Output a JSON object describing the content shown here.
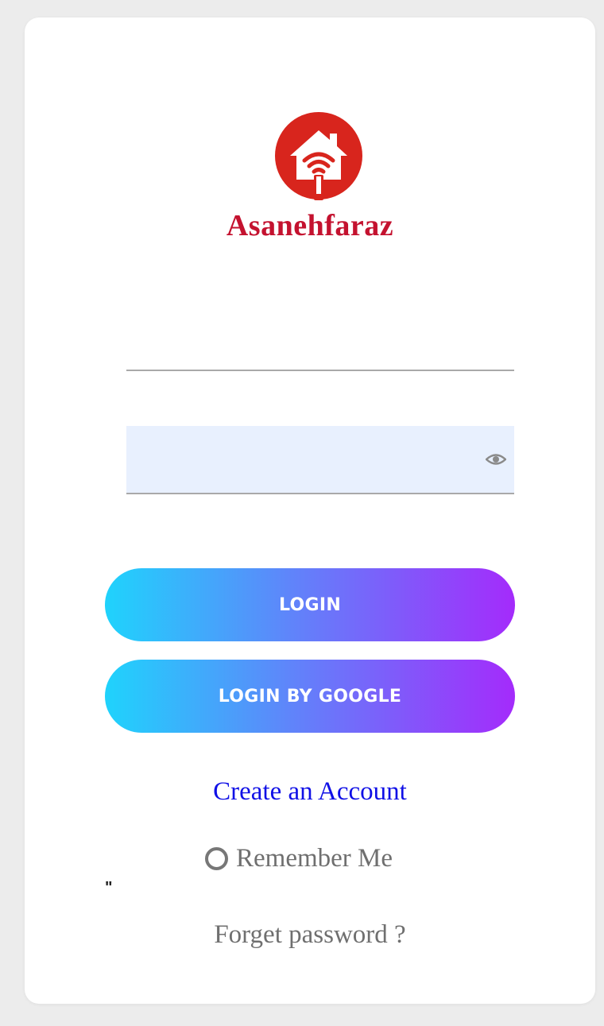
{
  "brand": {
    "name": "Asanehfaraz",
    "logo_icon": "house-wifi-icon",
    "color": "#c4122f",
    "logo_color": "#d8251d"
  },
  "form": {
    "username": {
      "value": "",
      "placeholder": ""
    },
    "password": {
      "value": "",
      "placeholder": "",
      "toggle_icon": "eye-icon"
    },
    "login_label": "LOGIN",
    "google_label": "LOGIN BY GOOGLE",
    "create_account_label": "Create an Account",
    "remember_label": "Remember Me",
    "stray_text": "\"",
    "forget_label": "Forget password ?"
  },
  "colors": {
    "gradient_start": "#1fd3fc",
    "gradient_end": "#a42bfb",
    "link": "#1010e6",
    "autofill_bg": "#e8f0fe"
  }
}
